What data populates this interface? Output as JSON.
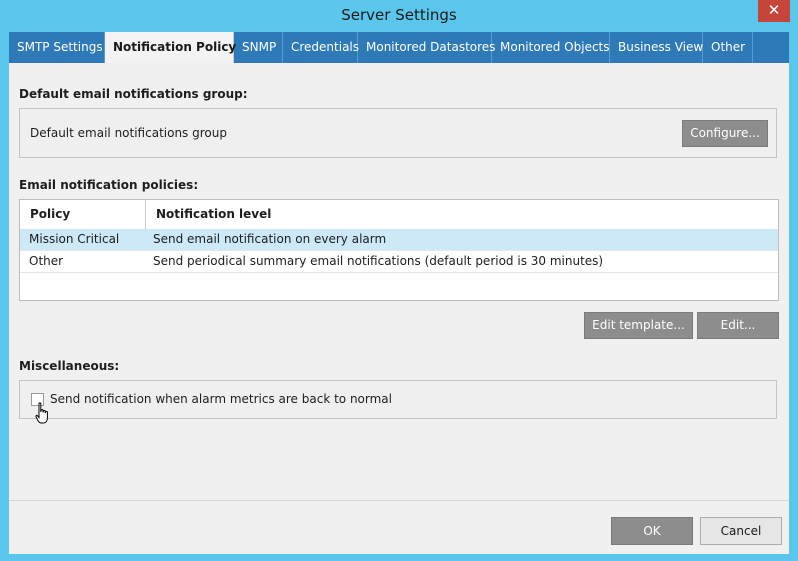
{
  "window": {
    "title": "Server Settings",
    "close_label": "✕"
  },
  "tabs": [
    {
      "label": "SMTP Settings",
      "active": false
    },
    {
      "label": "Notification Policy",
      "active": true
    },
    {
      "label": "SNMP",
      "active": false
    },
    {
      "label": "Credentials",
      "active": false
    },
    {
      "label": "Monitored Datastores",
      "active": false
    },
    {
      "label": "Monitored Objects",
      "active": false
    },
    {
      "label": "Business View",
      "active": false
    },
    {
      "label": "Other",
      "active": false
    }
  ],
  "default_group": {
    "section_label": "Default email notifications group:",
    "value": "Default email notifications group",
    "configure_label": "Configure..."
  },
  "policies": {
    "section_label": "Email notification policies:",
    "columns": [
      "Policy",
      "Notification level"
    ],
    "rows": [
      {
        "policy": "Mission Critical",
        "level": "Send email notification on every alarm",
        "selected": true
      },
      {
        "policy": "Other",
        "level": "Send periodical summary email notifications (default period is 30 minutes)",
        "selected": false
      }
    ],
    "edit_template_label": "Edit template...",
    "edit_label": "Edit..."
  },
  "misc": {
    "section_label": "Miscellaneous:",
    "checkbox_label": "Send notification when alarm metrics are back to normal",
    "checked": false
  },
  "footer": {
    "ok_label": "OK",
    "cancel_label": "Cancel"
  }
}
